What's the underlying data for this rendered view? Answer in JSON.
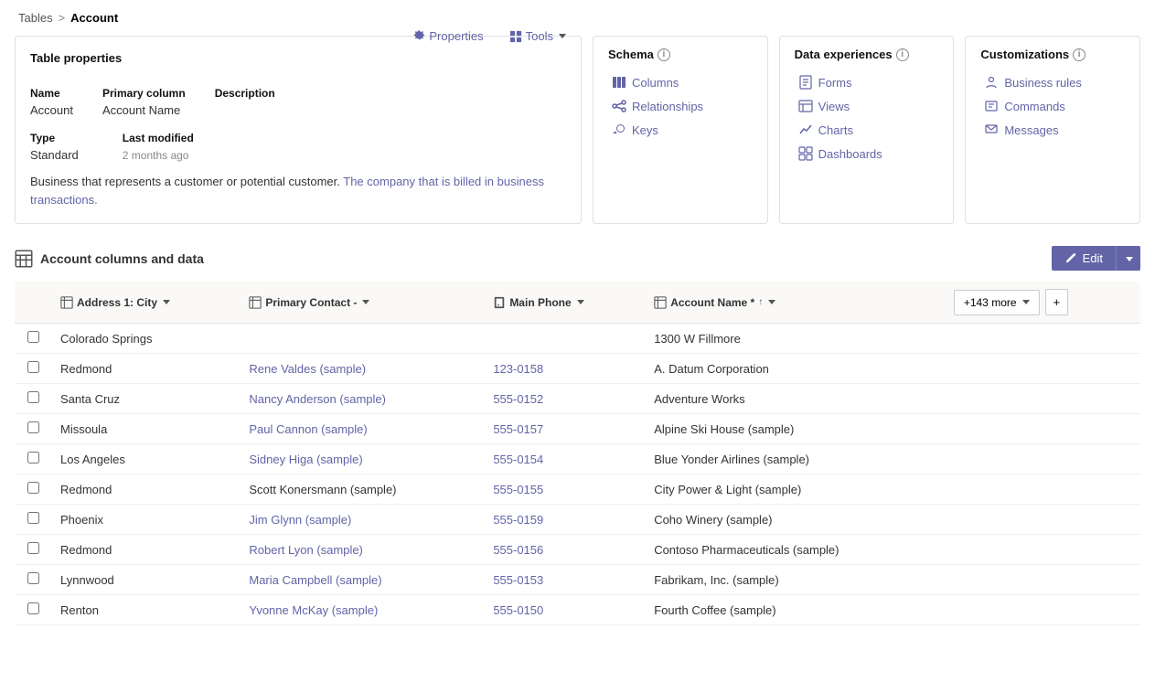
{
  "breadcrumb": {
    "parent": "Tables",
    "separator": ">",
    "current": "Account"
  },
  "tableProperties": {
    "sectionTitle": "Table properties",
    "toolbar": {
      "properties": "Properties",
      "tools": "Tools"
    },
    "columns": [
      {
        "label": "Name",
        "value": "Account"
      },
      {
        "label": "Primary column",
        "value": "Account Name"
      },
      {
        "label": "Description",
        "value": ""
      }
    ],
    "typeLabel": "Type",
    "typeValue": "Standard",
    "lastModifiedLabel": "Last modified",
    "lastModifiedValue": "2 months ago",
    "description": "Business that represents a customer or potential customer.",
    "descriptionLink1": "The company that is billed in business transactions."
  },
  "schema": {
    "title": "Schema",
    "links": [
      {
        "label": "Columns",
        "icon": "columns"
      },
      {
        "label": "Relationships",
        "icon": "relationships"
      },
      {
        "label": "Keys",
        "icon": "keys"
      }
    ]
  },
  "dataExperiences": {
    "title": "Data experiences",
    "links": [
      {
        "label": "Forms",
        "icon": "forms"
      },
      {
        "label": "Views",
        "icon": "views"
      },
      {
        "label": "Charts",
        "icon": "charts"
      },
      {
        "label": "Dashboards",
        "icon": "dashboards"
      }
    ]
  },
  "customizations": {
    "title": "Customizations",
    "links": [
      {
        "label": "Business rules",
        "icon": "business-rules"
      },
      {
        "label": "Commands",
        "icon": "commands"
      },
      {
        "label": "Messages",
        "icon": "messages"
      }
    ]
  },
  "dataSection": {
    "title": "Account columns and data",
    "editLabel": "Edit",
    "columns": [
      {
        "label": "Address 1: City",
        "sortable": true
      },
      {
        "label": "Primary Contact",
        "sortable": false
      },
      {
        "label": "Main Phone",
        "sortable": false
      },
      {
        "label": "Account Name *",
        "sortable": true,
        "sorted": true
      }
    ],
    "moreColumns": "+143 more",
    "rows": [
      {
        "city": "Colorado Springs",
        "contact": "",
        "phone": "",
        "account": "1300 W Fillmore",
        "contactLink": false
      },
      {
        "city": "Redmond",
        "contact": "Rene Valdes (sample)",
        "phone": "123-0158",
        "account": "A. Datum Corporation",
        "contactLink": true
      },
      {
        "city": "Santa Cruz",
        "contact": "Nancy Anderson (sample)",
        "phone": "555-0152",
        "account": "Adventure Works",
        "contactLink": true
      },
      {
        "city": "Missoula",
        "contact": "Paul Cannon (sample)",
        "phone": "555-0157",
        "account": "Alpine Ski House (sample)",
        "contactLink": true
      },
      {
        "city": "Los Angeles",
        "contact": "Sidney Higa (sample)",
        "phone": "555-0154",
        "account": "Blue Yonder Airlines (sample)",
        "contactLink": true
      },
      {
        "city": "Redmond",
        "contact": "Scott Konersmann (sample)",
        "phone": "555-0155",
        "account": "City Power & Light (sample)",
        "contactLink": false
      },
      {
        "city": "Phoenix",
        "contact": "Jim Glynn (sample)",
        "phone": "555-0159",
        "account": "Coho Winery (sample)",
        "contactLink": true
      },
      {
        "city": "Redmond",
        "contact": "Robert Lyon (sample)",
        "phone": "555-0156",
        "account": "Contoso Pharmaceuticals (sample)",
        "contactLink": true
      },
      {
        "city": "Lynnwood",
        "contact": "Maria Campbell (sample)",
        "phone": "555-0153",
        "account": "Fabrikam, Inc. (sample)",
        "contactLink": true
      },
      {
        "city": "Renton",
        "contact": "Yvonne McKay (sample)",
        "phone": "555-0150",
        "account": "Fourth Coffee (sample)",
        "contactLink": true
      }
    ]
  }
}
